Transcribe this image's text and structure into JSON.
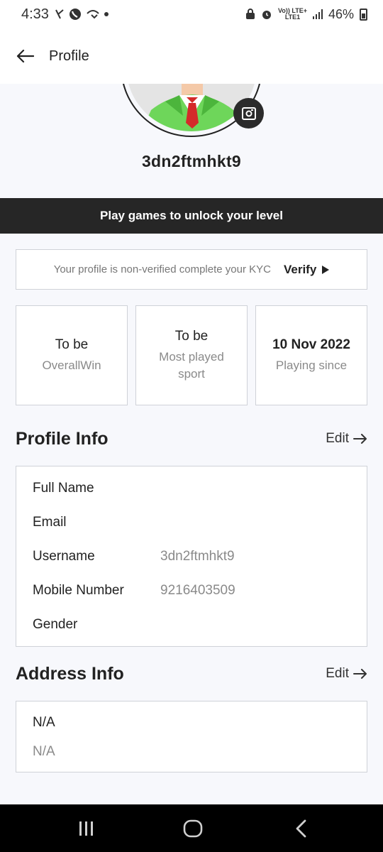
{
  "status_bar": {
    "time": "4:33",
    "network_label_top": "Vo)) LTE+",
    "network_label_bottom": "LTE1",
    "battery": "46%"
  },
  "header": {
    "title": "Profile"
  },
  "profile": {
    "username": "3dn2ftmhkt9"
  },
  "banner": {
    "text": "Play games to unlock your level"
  },
  "kyc": {
    "message": "Your profile is non-verified complete your KYC",
    "verify_label": "Verify"
  },
  "stats": [
    {
      "value": "To be",
      "label": "OverallWin"
    },
    {
      "value": "To be",
      "label": "Most played sport"
    },
    {
      "value": "10 Nov 2022",
      "label": "Playing since"
    }
  ],
  "profile_info": {
    "title": "Profile Info",
    "edit_label": "Edit",
    "rows": [
      {
        "key": "Full Name",
        "value": ""
      },
      {
        "key": "Email",
        "value": ""
      },
      {
        "key": "Username",
        "value": "3dn2ftmhkt9"
      },
      {
        "key": "Mobile Number",
        "value": "9216403509"
      },
      {
        "key": "Gender",
        "value": ""
      }
    ]
  },
  "address_info": {
    "title": "Address Info",
    "edit_label": "Edit",
    "line1": "N/A",
    "line2": "N/A"
  },
  "colors": {
    "page_bg": "#f7f8fc",
    "banner_bg": "#262626",
    "card_border": "#cfd2d8",
    "muted_text": "#8a8a8a",
    "nav_bar_bg": "#000000"
  },
  "icons": {
    "back": "arrow-left-icon",
    "camera": "camera-icon",
    "verify": "play-triangle-icon",
    "edit": "arrow-right-icon",
    "nav_recents": "recents-icon",
    "nav_home": "home-icon",
    "nav_back": "chevron-left-icon"
  }
}
